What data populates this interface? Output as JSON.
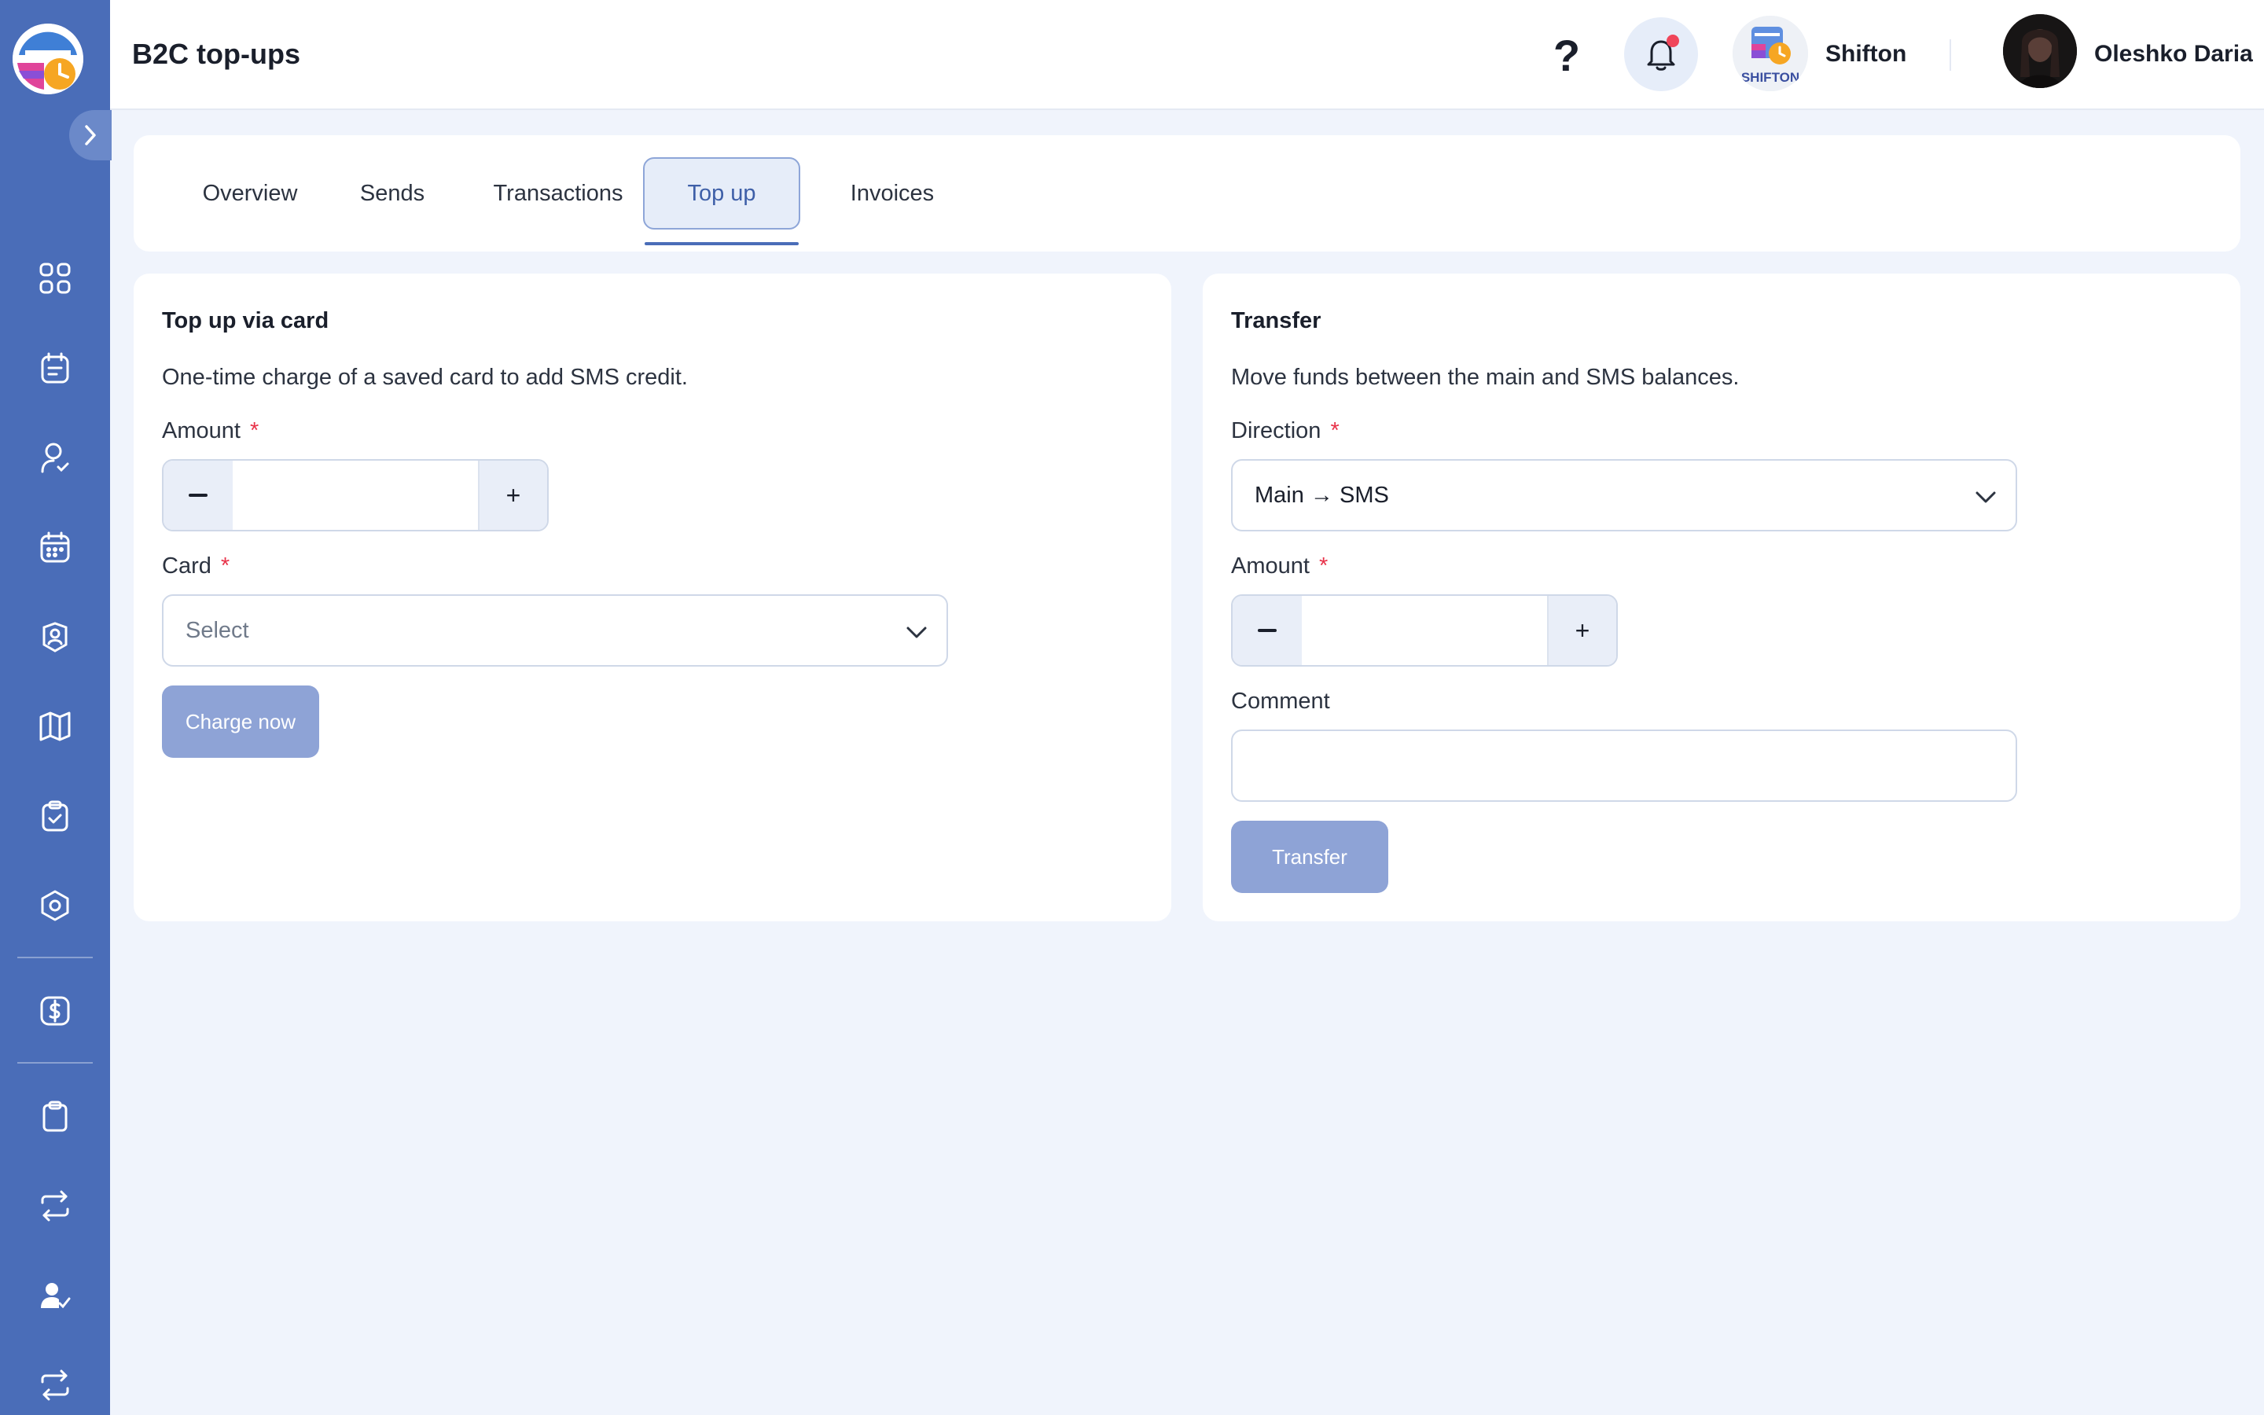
{
  "header": {
    "title": "B2C top-ups",
    "help_label": "?",
    "company_name": "Shifton",
    "company_logo_text": "SHIFTON",
    "user_name": "Oleshko Daria"
  },
  "sidebar": {
    "items": [
      {
        "icon": "dashboard-grid-icon"
      },
      {
        "icon": "schedule-list-icon"
      },
      {
        "icon": "employee-icon"
      },
      {
        "icon": "calendar-icon"
      },
      {
        "icon": "badge-icon"
      },
      {
        "icon": "map-icon"
      },
      {
        "icon": "tasks-icon"
      },
      {
        "icon": "settings-icon"
      },
      {
        "icon": "billing-dollar-icon"
      },
      {
        "icon": "clipboard-icon"
      },
      {
        "icon": "exchange-icon"
      },
      {
        "icon": "user-check-icon"
      },
      {
        "icon": "swap-icon"
      }
    ]
  },
  "tabs": [
    {
      "label": "Overview",
      "active": false
    },
    {
      "label": "Sends",
      "active": false
    },
    {
      "label": "Transactions",
      "active": false
    },
    {
      "label": "Top up",
      "active": true
    },
    {
      "label": "Invoices",
      "active": false
    }
  ],
  "topup": {
    "title": "Top up via card",
    "description": "One-time charge of a saved card to add SMS credit.",
    "amount_label": "Amount",
    "amount_value": "",
    "required_mark": "*",
    "card_label": "Card",
    "card_placeholder": "Select",
    "submit_label": "Charge now",
    "stepper_plus": "+"
  },
  "transfer": {
    "title": "Transfer",
    "description": "Move funds between the main and SMS balances.",
    "direction_label": "Direction",
    "direction_value": "Main → SMS",
    "required_mark": "*",
    "amount_label": "Amount",
    "amount_value": "",
    "comment_label": "Comment",
    "comment_value": "",
    "submit_label": "Transfer",
    "stepper_plus": "+"
  },
  "colors": {
    "sidebar": "#4a6db8",
    "accent": "#3e5fa8",
    "button_disabled": "#8ea3d6",
    "required": "#e8334a",
    "notification_dot": "#f0455a",
    "background": "#f0f4fc"
  }
}
